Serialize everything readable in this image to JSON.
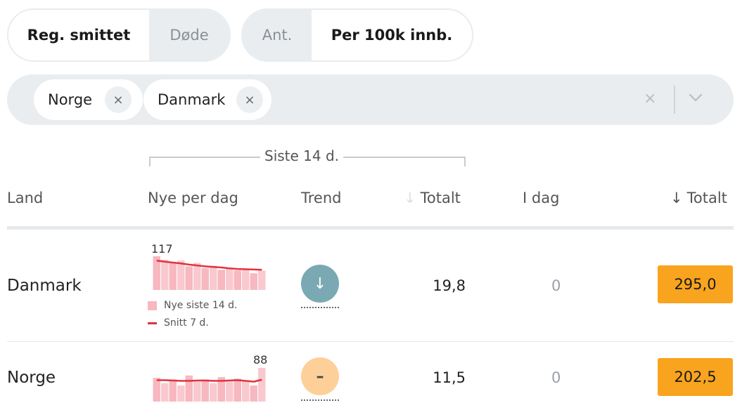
{
  "toggles": {
    "metric": {
      "active": "Reg. smittet",
      "inactive": "Døde"
    },
    "scale": {
      "inactive": "Ant.",
      "active": "Per 100k innb."
    }
  },
  "countries_selected": [
    {
      "label": "Norge",
      "remove": "×"
    },
    {
      "label": "Danmark",
      "remove": "×"
    }
  ],
  "countrybar": {
    "clear": "×"
  },
  "table": {
    "period_label": "Siste 14 d.",
    "headers": {
      "land": "Land",
      "nye_per_dag": "Nye per dag",
      "trend": "Trend",
      "totalt14": "Totalt",
      "i_dag": "I dag",
      "totalt": "Totalt"
    },
    "sort_arrow": "↓",
    "legend": {
      "bars": "Nye siste 14 d.",
      "line": "Snitt 7 d."
    },
    "rows": [
      {
        "country": "Danmark",
        "peak_label": "117",
        "trend_symbol": "↓",
        "total_14d": "19,8",
        "today": "0",
        "total": "295,0"
      },
      {
        "country": "Norge",
        "peak_label": "88",
        "trend_symbol": "–",
        "total_14d": "11,5",
        "today": "0",
        "total": "202,5"
      }
    ]
  },
  "chart_data": [
    {
      "type": "bar",
      "name": "Danmark",
      "categories": [
        "d1",
        "d2",
        "d3",
        "d4",
        "d5",
        "d6",
        "d7",
        "d8",
        "d9",
        "d10",
        "d11",
        "d12",
        "d13",
        "d14"
      ],
      "values": [
        117,
        105,
        95,
        102,
        82,
        94,
        76,
        84,
        70,
        74,
        68,
        72,
        58,
        67
      ],
      "line_values": [
        102,
        98,
        95,
        92,
        88,
        85,
        82,
        80,
        78,
        75,
        73,
        72,
        71,
        70
      ],
      "ylim": [
        0,
        117
      ]
    },
    {
      "type": "bar",
      "name": "Norge",
      "categories": [
        "d1",
        "d2",
        "d3",
        "d4",
        "d5",
        "d6",
        "d7",
        "d8",
        "d9",
        "d10",
        "d11",
        "d12",
        "d13",
        "d14"
      ],
      "values": [
        62,
        48,
        58,
        42,
        68,
        52,
        58,
        48,
        64,
        52,
        60,
        56,
        42,
        88
      ],
      "line_values": [
        56,
        56,
        55,
        54,
        54,
        55,
        55,
        54,
        54,
        55,
        56,
        54,
        52,
        57
      ],
      "ylim": [
        0,
        88
      ]
    }
  ],
  "colors": {
    "bars": "#f7b8c0",
    "avg_line": "#e0343e",
    "badge": "#f9a41e",
    "trend_down": "#7aa9b4",
    "trend_flat": "#fdd09a"
  }
}
